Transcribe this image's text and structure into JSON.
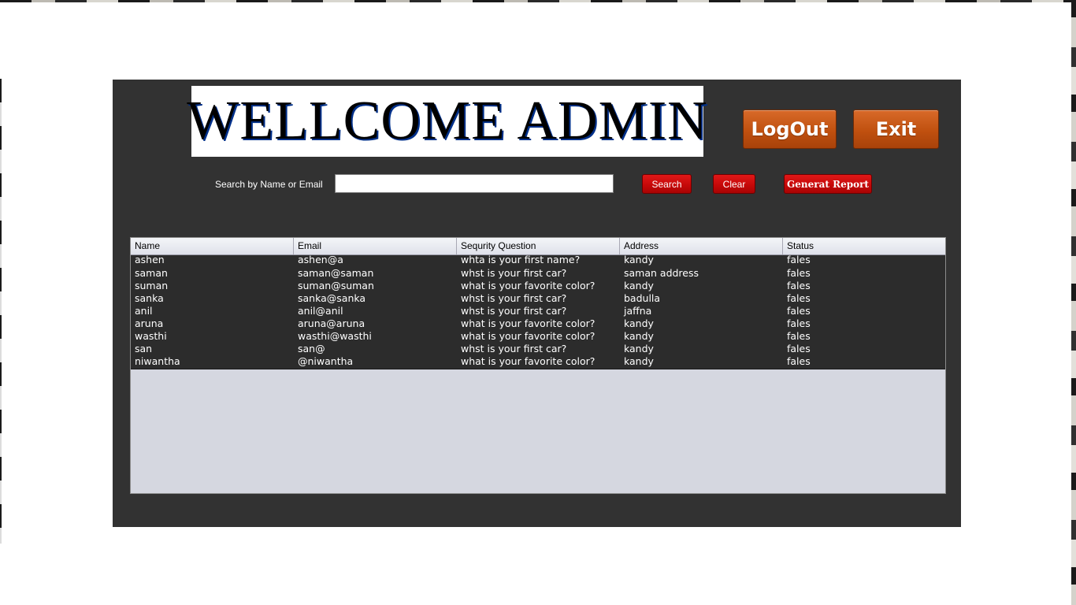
{
  "header": {
    "banner_text": "WELLCOME ADMIN",
    "logout_label": "LogOut",
    "exit_label": "Exit"
  },
  "search": {
    "label": "Search by Name or Email",
    "value": "",
    "search_label": "Search",
    "clear_label": "Clear",
    "report_label": "Generat Report"
  },
  "table": {
    "columns": [
      "Name",
      "Email",
      "Sequrity Question",
      "Address",
      "Status"
    ],
    "rows": [
      [
        "ashen",
        "ashen@a",
        "whta is your first name?",
        "kandy",
        "fales"
      ],
      [
        "saman",
        "saman@saman",
        "whst is your first car?",
        "saman address",
        "fales"
      ],
      [
        "suman",
        "suman@suman",
        "what is your favorite color?",
        "kandy",
        "fales"
      ],
      [
        "sanka",
        "sanka@sanka",
        "whst is your first car?",
        "badulla",
        "fales"
      ],
      [
        "anil",
        "anil@anil",
        "whst is your first car?",
        "jaffna",
        "fales"
      ],
      [
        "aruna",
        "aruna@aruna",
        "what is your favorite color?",
        "kandy",
        "fales"
      ],
      [
        "wasthi",
        "wasthi@wasthi",
        "what is your favorite color?",
        "kandy",
        "fales"
      ],
      [
        "san",
        "san@",
        "whst is your first car?",
        "kandy",
        "fales"
      ],
      [
        "niwantha",
        "@niwantha",
        "what is your favorite color?",
        "kandy",
        "fales"
      ]
    ]
  },
  "colors": {
    "panel_bg": "#323232",
    "orange_button": "#c0500f",
    "red_button": "#c40808",
    "table_empty_bg": "#d5d7e0"
  }
}
